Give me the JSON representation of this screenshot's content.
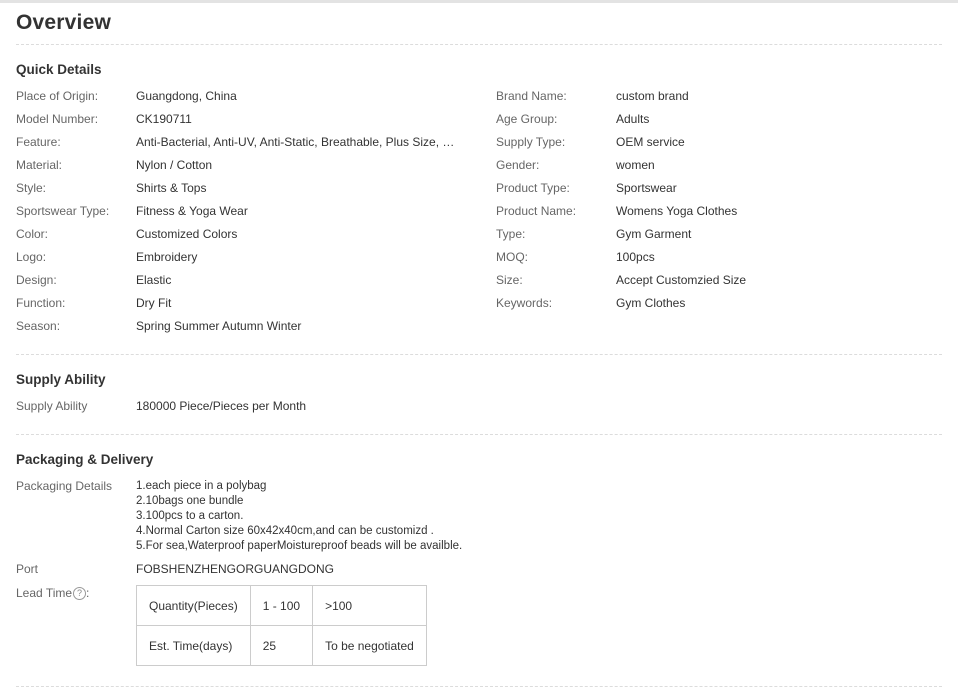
{
  "title": "Overview",
  "quick_details": {
    "heading": "Quick Details",
    "left": [
      {
        "label": "Place of Origin:",
        "value": "Guangdong, China"
      },
      {
        "label": "Model Number:",
        "value": "CK190711"
      },
      {
        "label": "Feature:",
        "value": "Anti-Bacterial, Anti-UV, Anti-Static, Breathable, Plus Size, QUI..."
      },
      {
        "label": "Material:",
        "value": "Nylon / Cotton"
      },
      {
        "label": "Style:",
        "value": "Shirts & Tops"
      },
      {
        "label": "Sportswear Type:",
        "value": "Fitness & Yoga Wear"
      },
      {
        "label": "Color:",
        "value": "Customized Colors"
      },
      {
        "label": "Logo:",
        "value": "Embroidery"
      },
      {
        "label": "Design:",
        "value": "Elastic"
      },
      {
        "label": "Function:",
        "value": "Dry Fit"
      },
      {
        "label": "Season:",
        "value": "Spring Summer Autumn Winter"
      }
    ],
    "right": [
      {
        "label": "Brand Name:",
        "value": "custom brand"
      },
      {
        "label": "Age Group:",
        "value": "Adults"
      },
      {
        "label": "Supply Type:",
        "value": "OEM service"
      },
      {
        "label": "Gender:",
        "value": "women"
      },
      {
        "label": "Product Type:",
        "value": "Sportswear"
      },
      {
        "label": "Product Name:",
        "value": "Womens Yoga Clothes"
      },
      {
        "label": "Type:",
        "value": "Gym Garment"
      },
      {
        "label": "MOQ:",
        "value": "100pcs"
      },
      {
        "label": "Size:",
        "value": "Accept Customzied Size"
      },
      {
        "label": "Keywords:",
        "value": "Gym Clothes"
      }
    ]
  },
  "supply_ability": {
    "heading": "Supply Ability",
    "label": "Supply Ability",
    "value": "180000 Piece/Pieces per Month"
  },
  "packaging": {
    "heading": "Packaging & Delivery",
    "details_label": "Packaging Details",
    "details_lines": [
      "1.each piece in a polybag",
      "2.10bags one bundle",
      "3.100pcs to a carton.",
      "4.Normal Carton size 60x42x40cm,and can be customizd .",
      "5.For sea,Waterproof paperMoistureproof beads will be availble."
    ],
    "port_label": "Port",
    "port_value": "FOBSHENZHENGORGUANGDONG",
    "lead_time_label": "Lead Time",
    "help_icon": "question-circle-icon",
    "help_glyph": "?",
    "colon": ":",
    "lead_table": [
      [
        "Quantity(Pieces)",
        "1 - 100",
        ">100"
      ],
      [
        "Est. Time(days)",
        "25",
        "To be negotiated"
      ]
    ]
  }
}
